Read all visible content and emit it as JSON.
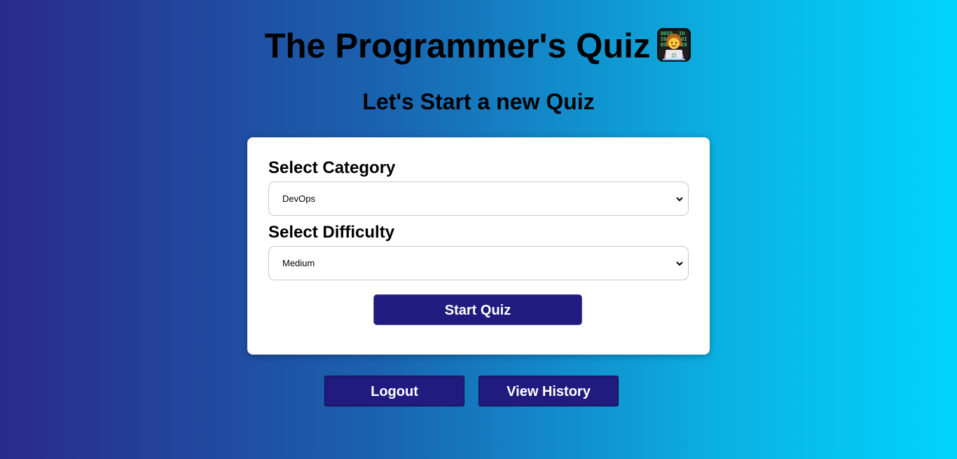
{
  "header": {
    "title": "The Programmer's Quiz",
    "emoji_icon": "technologist-emoji-icon",
    "subtitle": "Let's Start a new Quiz"
  },
  "form": {
    "category_label": "Select Category",
    "category_value": "DevOps",
    "difficulty_label": "Select Difficulty",
    "difficulty_value": "Medium",
    "start_label": "Start Quiz"
  },
  "actions": {
    "logout_label": "Logout",
    "history_label": "View History"
  },
  "colors": {
    "button_bg": "#211b7f",
    "gradient_start": "#2a2a8a",
    "gradient_end": "#00d4fe",
    "card_bg": "#ffffff"
  }
}
